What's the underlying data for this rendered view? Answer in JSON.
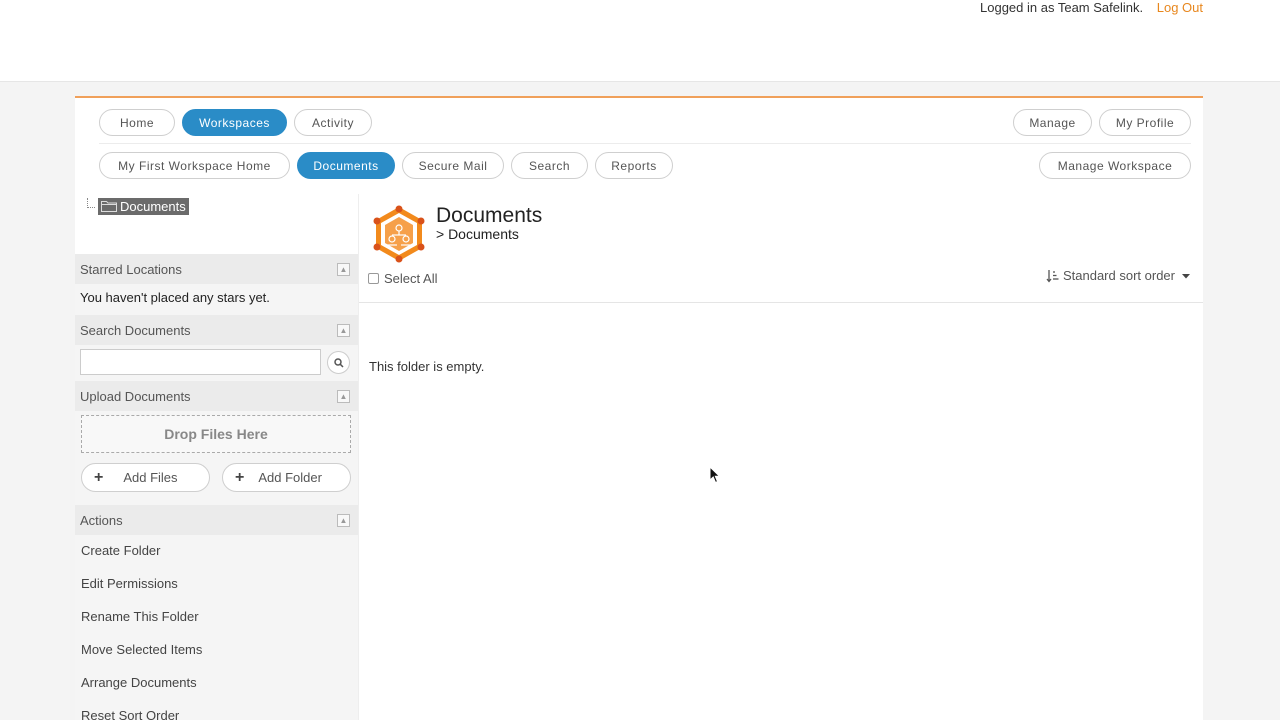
{
  "header": {
    "logged_in_text": "Logged in as Team Safelink.",
    "logout_label": "Log Out"
  },
  "nav_primary": {
    "left": [
      {
        "label": "Home",
        "active": false
      },
      {
        "label": "Workspaces",
        "active": true
      },
      {
        "label": "Activity",
        "active": false
      }
    ],
    "right": [
      {
        "label": "Manage"
      },
      {
        "label": "My Profile"
      }
    ]
  },
  "nav_secondary": {
    "left": [
      {
        "label": "My First Workspace Home",
        "active": false
      },
      {
        "label": "Documents",
        "active": true
      },
      {
        "label": "Secure Mail",
        "active": false
      },
      {
        "label": "Search",
        "active": false
      },
      {
        "label": "Reports",
        "active": false
      }
    ],
    "right": [
      {
        "label": "Manage Workspace"
      }
    ]
  },
  "tree": {
    "root_label": "Documents",
    "icon": "folder-icon"
  },
  "sidebar": {
    "starred": {
      "heading": "Starred Locations",
      "empty_text": "You haven't placed any stars yet."
    },
    "search": {
      "heading": "Search Documents",
      "value": "",
      "button_icon": "search-icon"
    },
    "upload": {
      "heading": "Upload Documents",
      "dropzone_label": "Drop Files Here",
      "add_files_label": "Add Files",
      "add_folder_label": "Add Folder"
    },
    "actions": {
      "heading": "Actions",
      "items": [
        "Create Folder",
        "Edit Permissions",
        "Rename This Folder",
        "Move Selected Items",
        "Arrange Documents",
        "Reset Sort Order"
      ]
    }
  },
  "content": {
    "title": "Documents",
    "breadcrumb": "> Documents",
    "select_all_label": "Select All",
    "sort_label": "Standard sort order",
    "empty_message": "This folder is empty."
  },
  "colors": {
    "accent_blue": "#2a8cc7",
    "accent_orange": "#e8871e"
  }
}
